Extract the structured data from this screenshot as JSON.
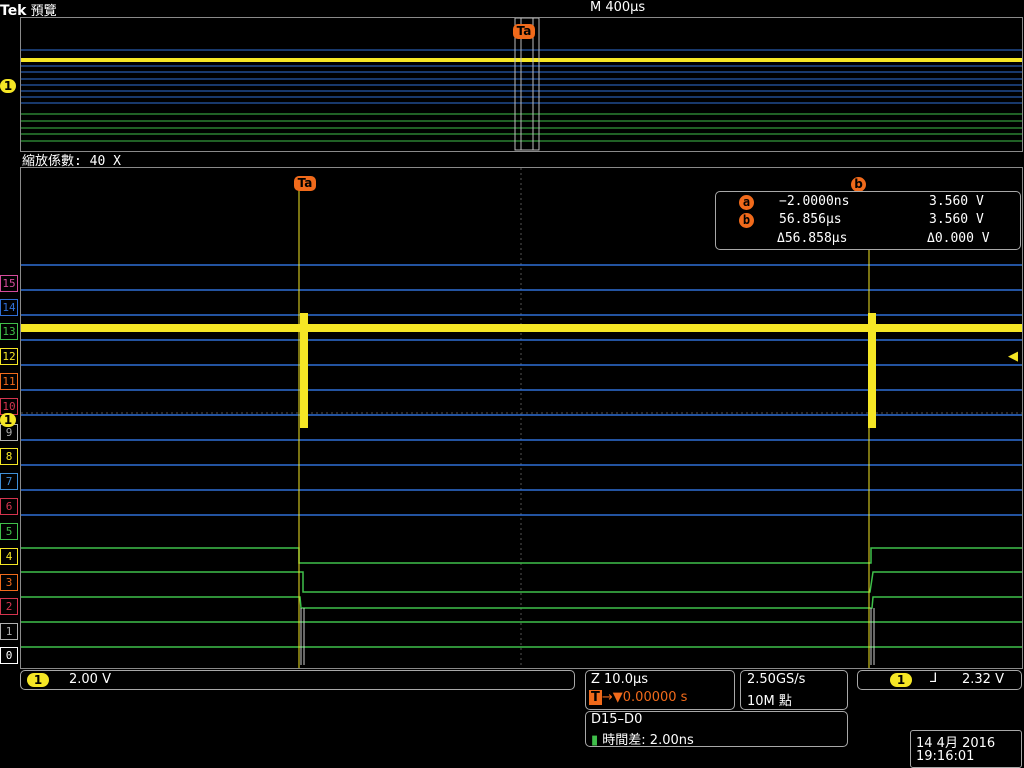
{
  "colors": {
    "trace_yellow": "#f5e625",
    "digital_blue": "#2f6fd6",
    "digital_green": "#3fbf4a",
    "cursor_orange": "#f06a1b",
    "grid_bg": "#000000"
  },
  "header": {
    "brand": "Tek",
    "mode": "預覽",
    "timebase": "M 400µs"
  },
  "zoom": {
    "factor_label": "縮放係數: 40 X"
  },
  "markers": {
    "trigger_a": "Ta",
    "cursor_b_top": "b",
    "ch1_small": "1"
  },
  "cursor_readout": {
    "a": {
      "label": "a",
      "time": "−2.0000ns",
      "volt": "3.560 V"
    },
    "b": {
      "label": "b",
      "time": "56.856µs",
      "volt": "3.560 V"
    },
    "delta": {
      "time": "Δ56.858µs",
      "volt": "Δ0.000 V"
    }
  },
  "digital_channels": [
    "15",
    "14",
    "13",
    "12",
    "11",
    "10",
    "9",
    "8",
    "7",
    "6",
    "5",
    "4",
    "3",
    "2",
    "1",
    "0"
  ],
  "channel_indicator": "1",
  "status_bar": {
    "ch1": {
      "badge": "1",
      "scale": "2.00 V"
    },
    "zoom_time": "Z 10.0µs",
    "trigger_pos_prefix": "T",
    "trigger_pos": "→▼0.00000 s",
    "sample_rate": "2.50GS/s",
    "record_length": "10M 點",
    "trigger": {
      "badge": "1",
      "slope": "⅃",
      "level": "2.32 V"
    },
    "bus": {
      "name": "D15–D0",
      "skew_label": "時間差: 2.00ns"
    },
    "date": "14 4月  2016",
    "time": "19:16:01"
  }
}
